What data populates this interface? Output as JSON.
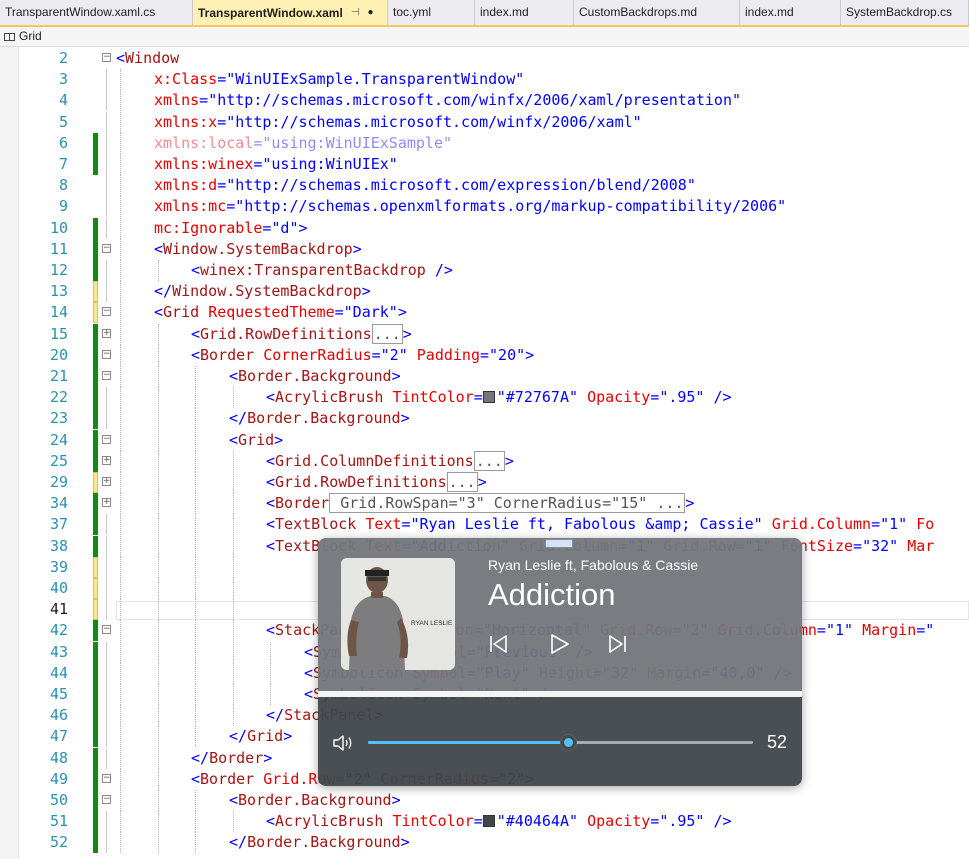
{
  "tabs": [
    {
      "label": "TransparentWindow.xaml.cs",
      "active": false
    },
    {
      "label": "TransparentWindow.xaml",
      "active": true
    },
    {
      "label": "toc.yml",
      "active": false
    },
    {
      "label": "index.md",
      "active": false
    },
    {
      "label": "CustomBackdrops.md",
      "active": false
    },
    {
      "label": "index.md",
      "active": false
    },
    {
      "label": "SystemBackdrop.cs",
      "active": false
    }
  ],
  "breadcrumb": {
    "label": "Grid",
    "icon": "grid-icon"
  },
  "editor": {
    "current_line": 41,
    "lines": [
      {
        "n": 2,
        "indent": 0,
        "fold": "minus",
        "change": "none",
        "tokens": [
          [
            "br",
            "<"
          ],
          [
            "tag",
            "Window"
          ]
        ]
      },
      {
        "n": 3,
        "indent": 1,
        "change": "none",
        "tokens": [
          [
            "attr",
            "x:Class"
          ],
          [
            "br",
            "="
          ],
          [
            "val",
            "\"WinUIExSample.TransparentWindow\""
          ]
        ]
      },
      {
        "n": 4,
        "indent": 1,
        "change": "none",
        "tokens": [
          [
            "attr",
            "xmlns"
          ],
          [
            "br",
            "="
          ],
          [
            "val",
            "\"http://schemas.microsoft.com/winfx/2006/xaml/presentation\""
          ]
        ]
      },
      {
        "n": 5,
        "indent": 1,
        "change": "none",
        "tokens": [
          [
            "attr",
            "xmlns:x"
          ],
          [
            "br",
            "="
          ],
          [
            "val",
            "\"http://schemas.microsoft.com/winfx/2006/xaml\""
          ]
        ]
      },
      {
        "n": 6,
        "indent": 1,
        "change": "green",
        "faded": true,
        "tokens": [
          [
            "attr",
            "xmlns:local"
          ],
          [
            "br",
            "="
          ],
          [
            "val",
            "\"using:WinUIExSample\""
          ]
        ]
      },
      {
        "n": 7,
        "indent": 1,
        "change": "green",
        "tokens": [
          [
            "attr",
            "xmlns:winex"
          ],
          [
            "br",
            "="
          ],
          [
            "val",
            "\"using:WinUIEx\""
          ]
        ]
      },
      {
        "n": 8,
        "indent": 1,
        "change": "none",
        "tokens": [
          [
            "attr",
            "xmlns:d"
          ],
          [
            "br",
            "="
          ],
          [
            "val",
            "\"http://schemas.microsoft.com/expression/blend/2008\""
          ]
        ]
      },
      {
        "n": 9,
        "indent": 1,
        "change": "none",
        "tokens": [
          [
            "attr",
            "xmlns:mc"
          ],
          [
            "br",
            "="
          ],
          [
            "val",
            "\"http://schemas.openxmlformats.org/markup-compatibility/2006\""
          ]
        ]
      },
      {
        "n": 10,
        "indent": 1,
        "change": "green",
        "tokens": [
          [
            "attr",
            "mc:Ignorable"
          ],
          [
            "br",
            "="
          ],
          [
            "val",
            "\"d\""
          ],
          [
            "br",
            ">"
          ]
        ]
      },
      {
        "n": 11,
        "indent": 1,
        "fold": "minus",
        "change": "green",
        "tokens": [
          [
            "br",
            "<"
          ],
          [
            "tag",
            "Window.SystemBackdrop"
          ],
          [
            "br",
            ">"
          ]
        ]
      },
      {
        "n": 12,
        "indent": 2,
        "change": "green",
        "tokens": [
          [
            "br",
            "<"
          ],
          [
            "tag",
            "winex:TransparentBackdrop"
          ],
          [
            "txt",
            " "
          ],
          [
            "br",
            "/>"
          ]
        ]
      },
      {
        "n": 13,
        "indent": 1,
        "change": "yellow",
        "tokens": [
          [
            "br",
            "</"
          ],
          [
            "tag",
            "Window.SystemBackdrop"
          ],
          [
            "br",
            ">"
          ]
        ]
      },
      {
        "n": 14,
        "indent": 1,
        "fold": "minus",
        "change": "yellow",
        "tokens": [
          [
            "br",
            "<"
          ],
          [
            "tag",
            "Grid"
          ],
          [
            "txt",
            " "
          ],
          [
            "attr",
            "RequestedTheme"
          ],
          [
            "br",
            "="
          ],
          [
            "val",
            "\"Dark\""
          ],
          [
            "br",
            ">"
          ]
        ]
      },
      {
        "n": 15,
        "indent": 2,
        "fold": "plus",
        "change": "green",
        "tokens": [
          [
            "br",
            "<"
          ],
          [
            "tag",
            "Grid.RowDefinitions"
          ],
          [
            "collapsed",
            "..."
          ],
          [
            "br",
            ">"
          ]
        ]
      },
      {
        "n": 20,
        "indent": 2,
        "fold": "minus",
        "change": "green",
        "tokens": [
          [
            "br",
            "<"
          ],
          [
            "tag",
            "Border"
          ],
          [
            "txt",
            " "
          ],
          [
            "attr",
            "CornerRadius"
          ],
          [
            "br",
            "="
          ],
          [
            "val",
            "\"2\""
          ],
          [
            "txt",
            " "
          ],
          [
            "attr",
            "Padding"
          ],
          [
            "br",
            "="
          ],
          [
            "val",
            "\"20\""
          ],
          [
            "br",
            ">"
          ]
        ]
      },
      {
        "n": 21,
        "indent": 3,
        "fold": "minus",
        "change": "green",
        "tokens": [
          [
            "br",
            "<"
          ],
          [
            "tag",
            "Border.Background"
          ],
          [
            "br",
            ">"
          ]
        ]
      },
      {
        "n": 22,
        "indent": 4,
        "change": "green",
        "tokens": [
          [
            "br",
            "<"
          ],
          [
            "tag",
            "AcrylicBrush"
          ],
          [
            "txt",
            " "
          ],
          [
            "attr",
            "TintColor"
          ],
          [
            "br",
            "="
          ],
          [
            "swatch",
            "#72767A"
          ],
          [
            "val",
            "\"#72767A\""
          ],
          [
            "txt",
            " "
          ],
          [
            "attr",
            "Opacity"
          ],
          [
            "br",
            "="
          ],
          [
            "val",
            "\".95\""
          ],
          [
            "txt",
            " "
          ],
          [
            "br",
            "/>"
          ]
        ]
      },
      {
        "n": 23,
        "indent": 3,
        "change": "green",
        "tokens": [
          [
            "br",
            "</"
          ],
          [
            "tag",
            "Border.Background"
          ],
          [
            "br",
            ">"
          ]
        ]
      },
      {
        "n": 24,
        "indent": 3,
        "fold": "minus",
        "change": "green",
        "tokens": [
          [
            "br",
            "<"
          ],
          [
            "tag",
            "Grid"
          ],
          [
            "br",
            ">"
          ]
        ]
      },
      {
        "n": 25,
        "indent": 4,
        "fold": "plus",
        "change": "green",
        "tokens": [
          [
            "br",
            "<"
          ],
          [
            "tag",
            "Grid.ColumnDefinitions"
          ],
          [
            "collapsed",
            "..."
          ],
          [
            "br",
            ">"
          ]
        ]
      },
      {
        "n": 29,
        "indent": 4,
        "fold": "plus",
        "change": "yellow",
        "tokens": [
          [
            "br",
            "<"
          ],
          [
            "tag",
            "Grid.RowDefinitions"
          ],
          [
            "collapsed",
            "..."
          ],
          [
            "br",
            ">"
          ]
        ]
      },
      {
        "n": 34,
        "indent": 4,
        "fold": "plus",
        "change": "green",
        "tokens": [
          [
            "br",
            "<"
          ],
          [
            "tag",
            "Border"
          ],
          [
            "collapsed",
            " Grid.RowSpan=\"3\" CornerRadius=\"15\" ..."
          ],
          [
            "br",
            ">"
          ]
        ]
      },
      {
        "n": 37,
        "indent": 4,
        "change": "green",
        "tokens": [
          [
            "br",
            "<"
          ],
          [
            "tag",
            "TextBlock"
          ],
          [
            "txt",
            " "
          ],
          [
            "attr",
            "Text"
          ],
          [
            "br",
            "="
          ],
          [
            "val",
            "\"Ryan Leslie ft, Fabolous &amp; Cassie\""
          ],
          [
            "txt",
            " "
          ],
          [
            "attr",
            "Grid.Column"
          ],
          [
            "br",
            "="
          ],
          [
            "val",
            "\"1\""
          ],
          [
            "txt",
            " "
          ],
          [
            "attr",
            "Fo"
          ]
        ]
      },
      {
        "n": 38,
        "indent": 4,
        "change": "green",
        "tokens": [
          [
            "br",
            "<"
          ],
          [
            "tag",
            "TextBlock"
          ],
          [
            "txt",
            " "
          ],
          [
            "attr",
            "Text"
          ],
          [
            "br",
            "="
          ],
          [
            "val",
            "\"Addiction\""
          ],
          [
            "txt",
            " "
          ],
          [
            "attr",
            "Grid.Column"
          ],
          [
            "br",
            "="
          ],
          [
            "val",
            "\"1\""
          ],
          [
            "txt",
            " "
          ],
          [
            "attr",
            "Grid.Row"
          ],
          [
            "br",
            "="
          ],
          [
            "val",
            "\"1\""
          ],
          [
            "txt",
            " "
          ],
          [
            "attr",
            "FontSize"
          ],
          [
            "br",
            "="
          ],
          [
            "val",
            "\"32\""
          ],
          [
            "txt",
            " "
          ],
          [
            "attr",
            "Mar"
          ]
        ]
      },
      {
        "n": 39,
        "indent": 4,
        "change": "yellow",
        "tokens": []
      },
      {
        "n": 40,
        "indent": 4,
        "change": "yellow",
        "tokens": []
      },
      {
        "n": 41,
        "indent": 4,
        "change": "yellow",
        "tokens": []
      },
      {
        "n": 42,
        "indent": 4,
        "fold": "minus",
        "change": "green",
        "tokens": [
          [
            "br",
            "<"
          ],
          [
            "tag",
            "StackPanel"
          ],
          [
            "txt",
            " "
          ],
          [
            "attr",
            "Orientation"
          ],
          [
            "br",
            "="
          ],
          [
            "val",
            "\"Horizontal\""
          ],
          [
            "txt",
            " "
          ],
          [
            "attr",
            "Grid.Row"
          ],
          [
            "br",
            "="
          ],
          [
            "val",
            "\"2\""
          ],
          [
            "txt",
            " "
          ],
          [
            "attr",
            "Grid.Column"
          ],
          [
            "br",
            "="
          ],
          [
            "val",
            "\"1\""
          ],
          [
            "txt",
            " "
          ],
          [
            "attr",
            "Margin"
          ],
          [
            "br",
            "="
          ],
          [
            "val",
            "\""
          ]
        ]
      },
      {
        "n": 43,
        "indent": 5,
        "change": "green",
        "tokens": [
          [
            "br",
            "<"
          ],
          [
            "tag",
            "SymbolIcon"
          ],
          [
            "txt",
            " "
          ],
          [
            "attr",
            "Symbol"
          ],
          [
            "br",
            "="
          ],
          [
            "val",
            "\"Previous\""
          ],
          [
            "txt",
            " "
          ],
          [
            "br",
            "/>"
          ]
        ]
      },
      {
        "n": 44,
        "indent": 5,
        "change": "green",
        "tokens": [
          [
            "br",
            "<"
          ],
          [
            "tag",
            "SymbolIcon"
          ],
          [
            "txt",
            " "
          ],
          [
            "attr",
            "Symbol"
          ],
          [
            "br",
            "="
          ],
          [
            "val",
            "\"Play\""
          ],
          [
            "txt",
            " "
          ],
          [
            "attr",
            "Height"
          ],
          [
            "br",
            "="
          ],
          [
            "val",
            "\"32\""
          ],
          [
            "txt",
            " "
          ],
          [
            "attr",
            "Margin"
          ],
          [
            "br",
            "="
          ],
          [
            "val",
            "\"40,0\""
          ],
          [
            "txt",
            " "
          ],
          [
            "br",
            "/>"
          ]
        ]
      },
      {
        "n": 45,
        "indent": 5,
        "change": "green",
        "tokens": [
          [
            "br",
            "<"
          ],
          [
            "tag",
            "SymbolIcon"
          ],
          [
            "txt",
            " "
          ],
          [
            "attr",
            "Symbol"
          ],
          [
            "br",
            "="
          ],
          [
            "val",
            "\"Next\""
          ],
          [
            "txt",
            " "
          ],
          [
            "br",
            "/>"
          ]
        ]
      },
      {
        "n": 46,
        "indent": 4,
        "change": "green",
        "tokens": [
          [
            "br",
            "</"
          ],
          [
            "tag",
            "StackPanel"
          ],
          [
            "br",
            ">"
          ]
        ]
      },
      {
        "n": 47,
        "indent": 3,
        "change": "green",
        "tokens": [
          [
            "br",
            "</"
          ],
          [
            "tag",
            "Grid"
          ],
          [
            "br",
            ">"
          ]
        ]
      },
      {
        "n": 48,
        "indent": 2,
        "change": "green",
        "tokens": [
          [
            "br",
            "</"
          ],
          [
            "tag",
            "Border"
          ],
          [
            "br",
            ">"
          ]
        ]
      },
      {
        "n": 49,
        "indent": 2,
        "fold": "minus",
        "change": "green",
        "tokens": [
          [
            "br",
            "<"
          ],
          [
            "tag",
            "Border"
          ],
          [
            "txt",
            " "
          ],
          [
            "attr",
            "Grid.Row"
          ],
          [
            "br",
            "="
          ],
          [
            "val",
            "\"2\""
          ],
          [
            "txt",
            " "
          ],
          [
            "attr",
            "CornerRadius"
          ],
          [
            "br",
            "="
          ],
          [
            "val",
            "\"2\""
          ],
          [
            "br",
            ">"
          ]
        ]
      },
      {
        "n": 50,
        "indent": 3,
        "fold": "minus",
        "change": "green",
        "tokens": [
          [
            "br",
            "<"
          ],
          [
            "tag",
            "Border.Background"
          ],
          [
            "br",
            ">"
          ]
        ]
      },
      {
        "n": 51,
        "indent": 4,
        "change": "green",
        "tokens": [
          [
            "br",
            "<"
          ],
          [
            "tag",
            "AcrylicBrush"
          ],
          [
            "txt",
            " "
          ],
          [
            "attr",
            "TintColor"
          ],
          [
            "br",
            "="
          ],
          [
            "swatch",
            "#40464A"
          ],
          [
            "val",
            "\"#40464A\""
          ],
          [
            "txt",
            " "
          ],
          [
            "attr",
            "Opacity"
          ],
          [
            "br",
            "="
          ],
          [
            "val",
            "\".95\""
          ],
          [
            "txt",
            " "
          ],
          [
            "br",
            "/>"
          ]
        ]
      },
      {
        "n": 52,
        "indent": 3,
        "change": "green",
        "tokens": [
          [
            "br",
            "</"
          ],
          [
            "tag",
            "Border.Background"
          ],
          [
            "br",
            ">"
          ]
        ]
      }
    ]
  },
  "preview": {
    "artist": "Ryan Leslie ft, Fabolous & Cassie",
    "title": "Addiction",
    "album_art_caption": "RYAN LESLIE",
    "volume": 52,
    "volume_label": "52",
    "top_color": "#72767A",
    "bottom_color": "#40464A",
    "accent": "#4CC2FF",
    "controls": [
      "previous-icon",
      "play-icon",
      "next-icon"
    ]
  }
}
